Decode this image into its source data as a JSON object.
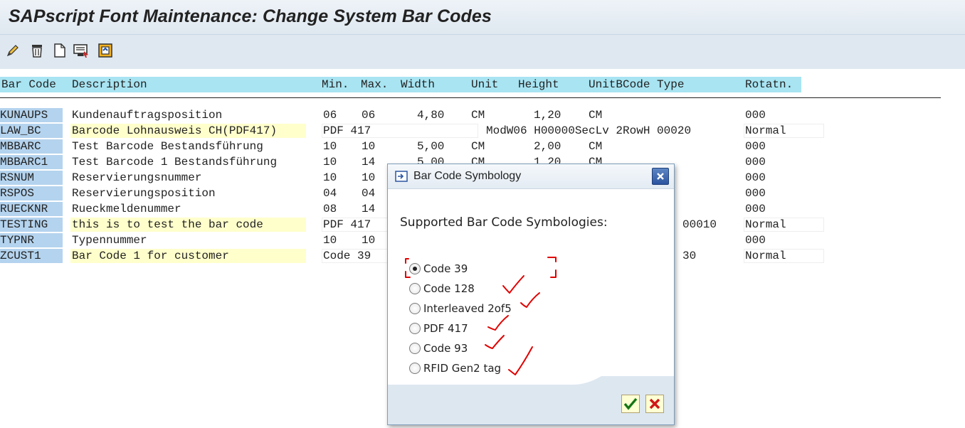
{
  "window": {
    "title": "SAPscript Font Maintenance: Change System Bar Codes"
  },
  "toolbar": {
    "buttons": [
      {
        "icon": "pencil-icon"
      },
      {
        "icon": "trash-icon"
      },
      {
        "icon": "new-document-icon"
      },
      {
        "icon": "display-icon"
      },
      {
        "icon": "transport-icon"
      }
    ]
  },
  "table": {
    "headers": {
      "bar_code": "Bar Code",
      "description": "Description",
      "min": "Min.",
      "max": "Max.",
      "width": "Width",
      "unit": "Unit",
      "height": "Height",
      "unit_bcode_type": "UnitBCode Type",
      "rotatn": "Rotatn."
    },
    "rows": [
      {
        "code": "KUNAUPS",
        "desc": "Kundenauftragsposition",
        "min": "06",
        "max": "06",
        "width": "4,80",
        "unit": "CM",
        "height": "1,20",
        "unit2": "CM",
        "btype": "",
        "rot": "000"
      },
      {
        "code": "LAW_BC",
        "desc": "Barcode Lohnausweis CH(PDF417)",
        "min": "PDF 417",
        "max": "",
        "width": "",
        "unit": "ModW06 H00000SecLv 2RowH 00020",
        "height": "",
        "unit2": "",
        "btype": "",
        "rot": "Normal"
      },
      {
        "code": "MBBARC",
        "desc": "Test Barcode Bestandsführung",
        "min": "10",
        "max": "10",
        "width": "5,00",
        "unit": "CM",
        "height": "2,00",
        "unit2": "CM",
        "btype": "",
        "rot": "000"
      },
      {
        "code": "MBBARC1",
        "desc": "Test Barcode 1 Bestandsführung",
        "min": "10",
        "max": "14",
        "width": "5,00",
        "unit": "CM",
        "height": "1,20",
        "unit2": "CM",
        "btype": "",
        "rot": "000"
      },
      {
        "code": "RSNUM",
        "desc": "Reservierungsnummer",
        "min": "10",
        "max": "10",
        "width": "",
        "unit": "",
        "height": "",
        "unit2": "",
        "btype": "",
        "rot": "000"
      },
      {
        "code": "RSPOS",
        "desc": "Reservierungsposition",
        "min": "04",
        "max": "04",
        "width": "",
        "unit": "",
        "height": "",
        "unit2": "",
        "btype": "",
        "rot": "000"
      },
      {
        "code": "RUECKNR",
        "desc": "Rueckmeldenummer",
        "min": "08",
        "max": "14",
        "width": "",
        "unit": "",
        "height": "",
        "unit2": "",
        "btype": "",
        "rot": "000"
      },
      {
        "code": "TESTING",
        "desc": "this is to test the bar code",
        "min": "PDF 417",
        "max": "",
        "width": "",
        "unit": "",
        "height": "",
        "unit2": "",
        "btype": "00010",
        "rot": "Normal"
      },
      {
        "code": "TYPNR",
        "desc": "Typennummer",
        "min": "10",
        "max": "10",
        "width": "",
        "unit": "",
        "height": "",
        "unit2": "",
        "btype": "",
        "rot": "000"
      },
      {
        "code": "ZCUST1",
        "desc": "Bar Code 1 for customer",
        "min": "Code 39",
        "max": "",
        "width": "",
        "unit": "",
        "height": "",
        "unit2": "",
        "btype": "30",
        "rot": "Normal"
      }
    ]
  },
  "dialog": {
    "title": "Bar Code Symbology",
    "heading": "Supported Bar Code Symbologies:",
    "options": [
      {
        "label": "Code 39",
        "checked": true
      },
      {
        "label": "Code 128",
        "checked": false
      },
      {
        "label": "Interleaved 2of5",
        "checked": false
      },
      {
        "label": "PDF 417",
        "checked": false
      },
      {
        "label": "Code 93",
        "checked": false
      },
      {
        "label": "RFID Gen2 tag",
        "checked": false
      }
    ],
    "ok_icon": "checkmark-icon",
    "cancel_icon": "cancel-x-icon"
  },
  "colors": {
    "header_bg": "#a8e4f2",
    "key_bg": "#b4d3ee",
    "special_row_bg": "#ffffcc",
    "annotation": "#e00000"
  }
}
